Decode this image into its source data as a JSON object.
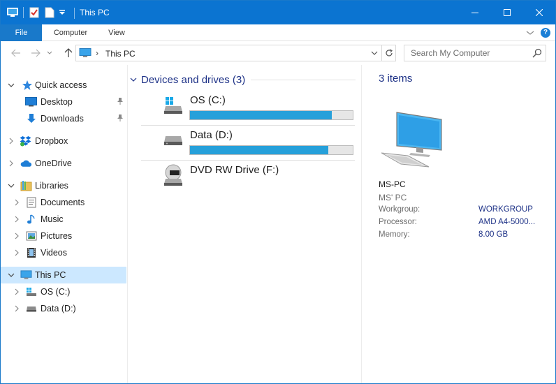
{
  "window": {
    "title": "This PC"
  },
  "ribbon": {
    "tabs": [
      "File",
      "Computer",
      "View"
    ],
    "help_label": "?"
  },
  "address": {
    "separator": "›",
    "location": "This PC"
  },
  "search": {
    "placeholder": "Search My Computer"
  },
  "nav": {
    "quick_access": "Quick access",
    "desktop": "Desktop",
    "downloads": "Downloads",
    "dropbox": "Dropbox",
    "onedrive": "OneDrive",
    "libraries": "Libraries",
    "documents": "Documents",
    "music": "Music",
    "pictures": "Pictures",
    "videos": "Videos",
    "this_pc": "This PC",
    "os_c": "OS (C:)",
    "data_d": "Data (D:)"
  },
  "content": {
    "group_title": "Devices and drives (3)",
    "drives": [
      {
        "name": "OS (C:)",
        "used_fraction": 0.87
      },
      {
        "name": "Data (D:)",
        "used_fraction": 0.85
      },
      {
        "name": "DVD RW Drive (F:)"
      }
    ]
  },
  "details": {
    "count": "3 items",
    "computer_name": "MS-PC",
    "description": "MS' PC",
    "workgroup_key": "Workgroup:",
    "workgroup_val": "WORKGROUP",
    "processor_key": "Processor:",
    "processor_val": "AMD A4-5000...",
    "memory_key": "Memory:",
    "memory_val": "8.00 GB"
  },
  "colors": {
    "titlebar": "#0b74d1",
    "accent": "#1979ca",
    "drive_bar": "#26a0da",
    "selected": "#cce8ff",
    "heading": "#1e3287"
  }
}
